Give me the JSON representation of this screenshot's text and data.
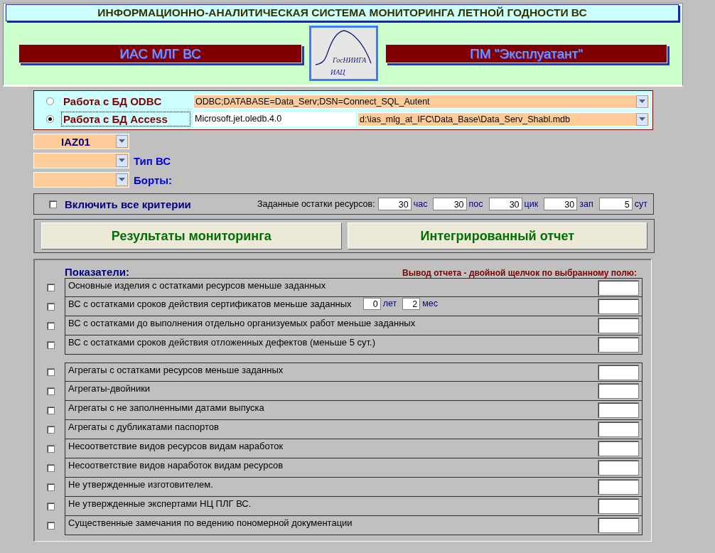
{
  "title": "ИНФОРМАЦИОННО-АНАЛИТИЧЕСКАЯ СИСТЕМА МОНИТОРИНГА ЛЕТНОЙ ГОДНОСТИ ВС",
  "header": {
    "left_banner": "ИАС МЛГ ВС",
    "logo": {
      "org": "ГосНИИГА",
      "sub": "ИАЦ"
    },
    "right_banner": "ПМ \"Эксплуатант\""
  },
  "connections": [
    {
      "label": "Работа с БД ODBC",
      "selected": false,
      "fields": [
        {
          "kind": "combo",
          "value": "ODBC;DATABASE=Data_Serv;DSN=Connect_SQL_Autent"
        }
      ]
    },
    {
      "label": "Работа с БД Access",
      "selected": true,
      "fields": [
        {
          "kind": "text",
          "value": "Microsoft.jet.oledb.4.0"
        },
        {
          "kind": "combo",
          "value": "d:\\ias_mlg_at_IFC\\Data_Base\\Data_Serv_Shabl.mdb"
        }
      ]
    }
  ],
  "filters": [
    {
      "value": "IAZ01"
    },
    {
      "label": "Тип ВС"
    },
    {
      "label": "Борты:"
    }
  ],
  "criteria": {
    "label": "Включить все критерии",
    "checked": false,
    "resources_label": "Заданные остатки ресурсов:",
    "resources": [
      {
        "value": "30",
        "unit": "час"
      },
      {
        "value": "30",
        "unit": "пос"
      },
      {
        "value": "30",
        "unit": "цик"
      },
      {
        "value": "30",
        "unit": "зап"
      },
      {
        "value": "5",
        "unit": "сут"
      }
    ]
  },
  "buttons": [
    "Результаты мониторинга",
    "Интегрированный отчет"
  ],
  "indicators": {
    "title": "Показатели:",
    "hint": "Вывод отчета - двойной щелчок по выбранному полю:",
    "groups": [
      [
        {
          "text": "Основные изделия с остатками ресурсов меньше заданных",
          "checked": false
        },
        {
          "text": "ВС с остатками сроков действия сертификатов меньше заданных",
          "checked": false,
          "extras": [
            {
              "value": "0",
              "unit": "лет"
            },
            {
              "value": "2",
              "unit": "мес"
            }
          ]
        },
        {
          "text": "ВС с остатками до  выполнения отдельно организуемых работ меньше заданных",
          "checked": false
        },
        {
          "text": "ВС с остатками сроков действия отложенных дефектов (меньше 5 сут.)",
          "checked": false
        }
      ],
      [
        {
          "text": "Агрегаты с остатками ресурсов меньше заданных",
          "checked": false
        },
        {
          "text": "Агрегаты-двойники",
          "checked": false
        },
        {
          "text": "Агрегаты с не заполненными датами выпуска",
          "checked": false
        },
        {
          "text": "Агрегаты с дубликатами паспортов",
          "checked": false
        },
        {
          "text": "Несоответствие видов ресурсов видам наработок",
          "checked": false
        },
        {
          "text": "Несоответствие видов наработок видам ресурсов",
          "checked": false
        },
        {
          "text": "Не утвержденные изготовителем.",
          "checked": false
        },
        {
          "text": "Не утвержденные экспертами НЦ ПЛГ ВС.",
          "checked": false
        },
        {
          "text": "Существенные замечания по ведению пономерной документации",
          "checked": false
        }
      ]
    ]
  }
}
